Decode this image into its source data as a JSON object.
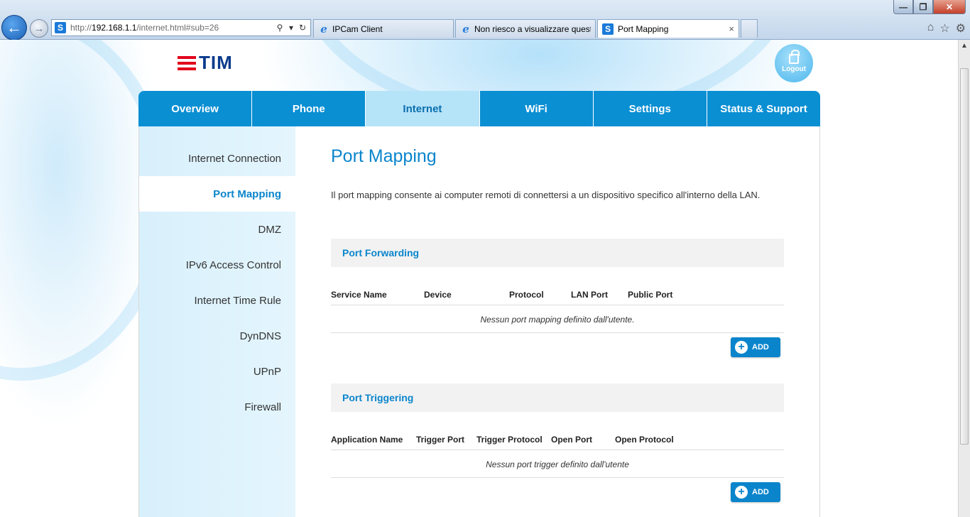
{
  "browser": {
    "address": {
      "prefix": "http://",
      "host": "192.168.1.1",
      "path": "/internet.html#sub=26",
      "site_icon": "S"
    },
    "tabs": [
      {
        "label": "IPCam Client",
        "icon": "ie-icon"
      },
      {
        "label": "Non riesco a visualizzare quest...",
        "icon": "ie-icon"
      },
      {
        "label": "Port Mapping",
        "icon": "site-icon",
        "active": true
      }
    ],
    "tab_close_glyph": "×",
    "site_icon_letter": "S"
  },
  "header": {
    "logo_text": "TIM",
    "logout_label": "Logout"
  },
  "main_nav": [
    {
      "label": "Overview"
    },
    {
      "label": "Phone"
    },
    {
      "label": "Internet",
      "active": true
    },
    {
      "label": "WiFi"
    },
    {
      "label": "Settings"
    },
    {
      "label": "Status & Support"
    }
  ],
  "side_menu": [
    {
      "label": "Internet Connection"
    },
    {
      "label": "Port Mapping",
      "active": true
    },
    {
      "label": "DMZ"
    },
    {
      "label": "IPv6 Access Control"
    },
    {
      "label": "Internet Time Rule"
    },
    {
      "label": "DynDNS"
    },
    {
      "label": "UPnP"
    },
    {
      "label": "Firewall"
    }
  ],
  "page": {
    "title": "Port Mapping",
    "description": "Il port mapping consente ai computer remoti di connettersi a un dispositivo specifico all'interno della LAN."
  },
  "port_forwarding": {
    "title": "Port Forwarding",
    "columns": [
      "Service Name",
      "Device",
      "Protocol",
      "LAN Port",
      "Public Port"
    ],
    "empty_message": "Nessun port mapping definito dall'utente.",
    "add_label": "ADD"
  },
  "port_triggering": {
    "title": "Port Triggering",
    "columns": [
      "Application Name",
      "Trigger Port",
      "Trigger Protocol",
      "Open Port",
      "Open Protocol"
    ],
    "empty_message": "Nessun port trigger definito dall'utente",
    "add_label": "ADD"
  },
  "colors": {
    "tim_blue": "#0a3a8c",
    "tim_red": "#e2001a",
    "accent": "#0a85cc",
    "nav": "#0a8fd3",
    "nav_active": "#b5e3f8"
  }
}
